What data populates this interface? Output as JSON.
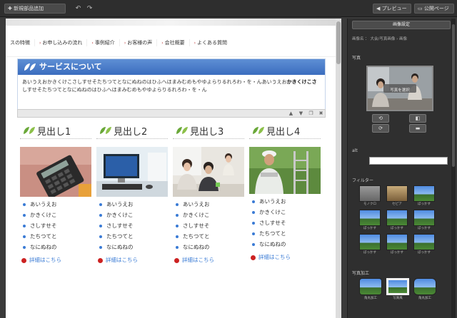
{
  "toolbar": {
    "add_part_label": "新規部品追加",
    "undo_icon": "undo-icon",
    "redo_icon": "redo-icon",
    "preview_label": "プレビュー",
    "publish_label": "公開ページ"
  },
  "nav": {
    "items": [
      "スの特徴",
      "お申し込みの流れ",
      "事例紹介",
      "お客様の声",
      "会社概要",
      "よくある質問"
    ]
  },
  "service": {
    "title": "サービスについて",
    "text_1": "あいうえおかきくけこさしすせそたちつてとなにぬねのはひふへほまみむめもやゆよらりるれろわ・を・んあいうえお",
    "text_bold": "かきくけこさ",
    "text_2": "しすせそたちつてとなにぬねのはひふへほまみむめもやゆよらりるれろわ・を・ん"
  },
  "columns": [
    {
      "heading": "見出し1",
      "items": [
        "あいうえお",
        "かきくけこ",
        "さしすせそ",
        "たちつてと",
        "なにぬねの"
      ],
      "more": "詳細はこちら"
    },
    {
      "heading": "見出し2",
      "items": [
        "あいうえお",
        "かきくけこ",
        "さしすせそ",
        "たちつてと",
        "なにぬねの"
      ],
      "more": "詳細はこちら"
    },
    {
      "heading": "見出し3",
      "items": [
        "あいうえお",
        "かきくけこ",
        "さしすせそ",
        "たちつてと",
        "なにぬねの"
      ],
      "more": "詳細はこちら"
    },
    {
      "heading": "見出し4",
      "items": [
        "あいうえお",
        "かきくけこ",
        "さしすせそ",
        "たちつてと",
        "なにぬねの"
      ],
      "more": "詳細はこちら"
    }
  ],
  "panel": {
    "tab_label": "画像設定",
    "crumb": "画像名 ： 大会/写真画像 › 画像",
    "photo_label": "写真",
    "photo_overlay": "写真を選択",
    "alt_label": "alt",
    "filter_label": "フィルター",
    "filters": [
      "モノクロ",
      "セピア",
      "ぼっかす",
      "ぼっかす",
      "ぼっかす",
      "ぼっかす",
      "ぼっかす",
      "ぼっかす",
      "ぼっかす"
    ],
    "process_label": "写真加工",
    "processes": [
      "角丸加工",
      "写真風",
      "角丸加工"
    ]
  },
  "colors": {
    "accent_blue": "#3b6dbf",
    "link_blue": "#3a7bd5",
    "leaf_green": "#6aa839"
  }
}
